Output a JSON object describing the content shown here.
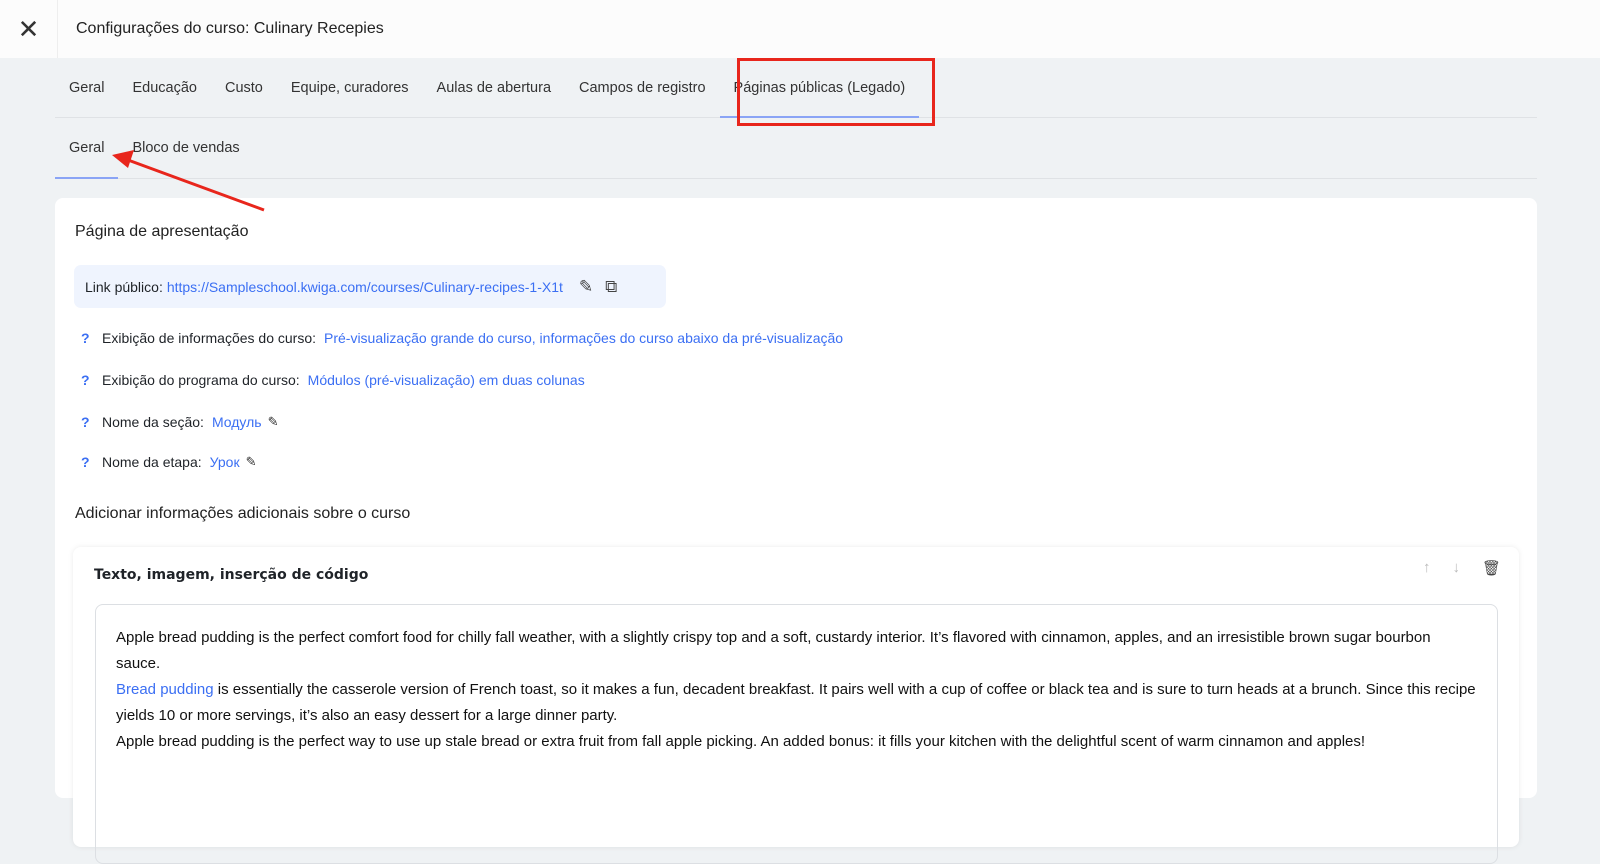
{
  "header": {
    "title": "Configurações do curso: Culinary Recepies",
    "close_icon": "close-icon"
  },
  "tabs": [
    "Geral",
    "Educação",
    "Custo",
    "Equipe, curadores",
    "Aulas de abertura",
    "Campos de registro",
    "Páginas públicas (Legado)"
  ],
  "subtabs": [
    "Geral",
    "Bloco de vendas"
  ],
  "page": {
    "heading": "Página de apresentação",
    "link_label": "Link público:",
    "link_url": "https://Sampleschool.kwiga.com/courses/Culinary-recipes-1-X1t",
    "settings": [
      {
        "label": "Exibição de informações do curso:",
        "value": "Pré-visualização grande do curso, informações do curso abaixo da pré-visualização"
      },
      {
        "label": "Exibição do programa do curso:",
        "value": "Módulos (pré-visualização) em duas colunas"
      },
      {
        "label": "Nome da seção:",
        "value": "Модуль"
      },
      {
        "label": "Nome da etapa:",
        "value": "Урок"
      }
    ],
    "help_mark": "?",
    "additional_heading": "Adicionar informações adicionais sobre o curso",
    "block": {
      "title": "Texto, imagem, inserção de código",
      "p1": "Apple bread pudding is the perfect comfort food for chilly fall weather, with a slightly crispy top and a soft, custardy interior. It’s flavored with cinnamon, apples, and an irresistible brown sugar bourbon sauce.",
      "p2_link": "Bread pudding",
      "p2_rest": " is essentially the casserole version of French toast, so it makes a fun, decadent breakfast. It pairs well with a cup of coffee or black tea and is sure to turn heads at a brunch. Since this recipe yields 10 or more servings, it’s also an easy dessert for a large dinner party.",
      "p3": "Apple bread pudding is the perfect way to use up stale bread or extra fruit from fall apple picking. An added bonus: it fills your kitchen with the delightful scent of warm cinnamon and apples!"
    }
  },
  "colors": {
    "accent": "#3b6ff3",
    "annotation": "#e8261c"
  }
}
